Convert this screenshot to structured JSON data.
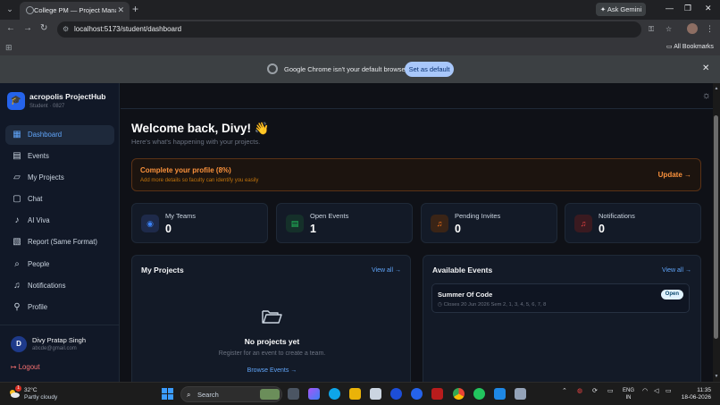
{
  "browser": {
    "tab_title": "College PM — Project Manage",
    "ask_gemini": "Ask Gemini",
    "url": "localhost:5173/student/dashboard",
    "all_bookmarks": "All Bookmarks",
    "infobar_text": "Google Chrome isn't your default browser",
    "infobar_button": "Set as default"
  },
  "sidebar": {
    "brand_name": "acropolis ProjectHub",
    "brand_sub": "Student · 0827",
    "items": [
      {
        "label": "Dashboard",
        "icon": "dashboard-icon",
        "active": true
      },
      {
        "label": "Events",
        "icon": "calendar-icon",
        "active": false
      },
      {
        "label": "My Projects",
        "icon": "folder-icon",
        "active": false
      },
      {
        "label": "Chat",
        "icon": "chat-icon",
        "active": false
      },
      {
        "label": "AI Viva",
        "icon": "mic-icon",
        "active": false
      },
      {
        "label": "Report (Same Format)",
        "icon": "report-icon",
        "active": false
      },
      {
        "label": "People",
        "icon": "search-icon",
        "active": false
      },
      {
        "label": "Notifications",
        "icon": "bell-icon",
        "active": false
      },
      {
        "label": "Profile",
        "icon": "user-icon",
        "active": false
      }
    ],
    "user": {
      "initial": "D",
      "name": "Divy Pratap Singh",
      "email": "abcde@gmail.com"
    },
    "logout": "Logout"
  },
  "main": {
    "welcome": "Welcome back, Divy! 👋",
    "welcome_sub": "Here's what's happening with your projects.",
    "profile_card": {
      "title": "Complete your profile (8%)",
      "desc": "Add more details so faculty can identify you easily",
      "action": "Update →",
      "percent": 8
    },
    "stats": [
      {
        "label": "My Teams",
        "value": "0",
        "icon": "users-icon",
        "color": "#3b82f6"
      },
      {
        "label": "Open Events",
        "value": "1",
        "icon": "calendar-icon",
        "color": "#22c55e"
      },
      {
        "label": "Pending Invites",
        "value": "0",
        "icon": "bell-icon",
        "color": "#f97316"
      },
      {
        "label": "Notifications",
        "value": "0",
        "icon": "bell-icon",
        "color": "#ef4444"
      }
    ],
    "projects_panel": {
      "title": "My Projects",
      "view_all": "View all →",
      "empty_title": "No projects yet",
      "empty_sub": "Register for an event to create a team.",
      "empty_link": "Browse Events →"
    },
    "events_panel": {
      "title": "Available Events",
      "view_all": "View all →",
      "events": [
        {
          "name": "Summer Of Code",
          "badge": "Open",
          "meta": "Closes 20 Jun 2026   Sem 2, 1, 3, 4, 5, 6, 7, 8"
        }
      ]
    }
  },
  "taskbar": {
    "temp": "32°C",
    "weather": "Partly cloudy",
    "weather_badge": "1",
    "search": "Search",
    "lang_1": "ENG",
    "lang_2": "IN",
    "time": "11:35",
    "date": "18-06-2026"
  }
}
